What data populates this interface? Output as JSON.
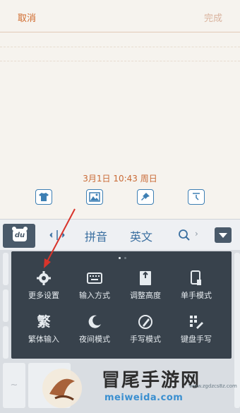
{
  "nav": {
    "cancel": "取消",
    "done": "完成"
  },
  "note": {
    "date": "3月1日 10:43 周日"
  },
  "note_tools": [
    {
      "name": "tshirt-icon"
    },
    {
      "name": "image-icon"
    },
    {
      "name": "pin-icon"
    },
    {
      "name": "clock-icon"
    }
  ],
  "keyboard": {
    "logo": "du",
    "mode_pinyin": "拼音",
    "mode_english": "英文",
    "more_arrow": "›"
  },
  "menu": {
    "items": [
      {
        "label": "更多设置",
        "icon": "gear-icon"
      },
      {
        "label": "输入方式",
        "icon": "keyboard-icon"
      },
      {
        "label": "调整高度",
        "icon": "height-icon"
      },
      {
        "label": "单手模式",
        "icon": "one-hand-icon"
      },
      {
        "label": "繁体输入",
        "icon": "traditional-chinese-icon",
        "glyph": "繁"
      },
      {
        "label": "夜间模式",
        "icon": "moon-icon"
      },
      {
        "label": "手写模式",
        "icon": "handwriting-icon"
      },
      {
        "label": "键盘手写",
        "icon": "keyboard-handwriting-icon"
      }
    ]
  },
  "watermark": {
    "title": "冒尾手游网",
    "sub": "meiweida.com",
    "url": "www.zgdzcs8z.com"
  },
  "colors": {
    "accent_orange": "#d06a2c",
    "icon_blue": "#3d7fb4",
    "menu_bg": "#38424c",
    "arrow_red": "#d9342b"
  }
}
